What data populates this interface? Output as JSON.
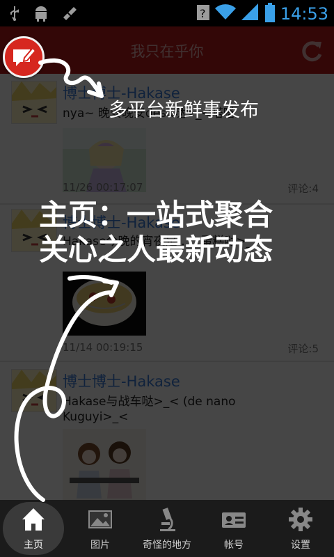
{
  "status_bar": {
    "time": "14:53",
    "icons": [
      "usb-icon",
      "android-debug-icon",
      "bug-icon",
      "signal-icon",
      "wifi-icon",
      "battery-icon"
    ]
  },
  "header": {
    "title": "我只在乎你",
    "compose_icon": "compose-icon",
    "refresh_icon": "refresh-icon"
  },
  "feed": {
    "posts": [
      {
        "author": "博士博士-Hakase",
        "content": "nya~ 晚安晚安desu哒>_<嗒嗒",
        "time": "11/26  00:17:07",
        "comments": "评论:4"
      },
      {
        "author": "博士博士-Hakase",
        "content": "Hakase今晚的宵夜是……蛋糕哒>_<",
        "time": "11/14  00:19:15",
        "comments": "评论:5"
      },
      {
        "author": "博士博士-Hakase",
        "content": "Hakase与战车哒>_< (de nano Kuguyi>_<",
        "time": "",
        "comments": ""
      }
    ]
  },
  "callouts": {
    "compose_hint": "多平台新鲜事发布",
    "home_hint_line1": "主页：一站式聚合",
    "home_hint_line2": "关心之人最新动态"
  },
  "bottom_nav": {
    "items": [
      {
        "label": "主页",
        "icon": "home-icon",
        "active": true
      },
      {
        "label": "图片",
        "icon": "picture-icon",
        "active": false
      },
      {
        "label": "奇怪的地方",
        "icon": "microscope-icon",
        "active": false
      },
      {
        "label": "帐号",
        "icon": "id-card-icon",
        "active": false
      },
      {
        "label": "设置",
        "icon": "gear-icon",
        "active": false
      }
    ]
  },
  "colors": {
    "title_bar": "#b61a1a",
    "compose_button": "#d6271f",
    "author_link": "#3b7bd6",
    "time_text": "#3aa0e8"
  }
}
